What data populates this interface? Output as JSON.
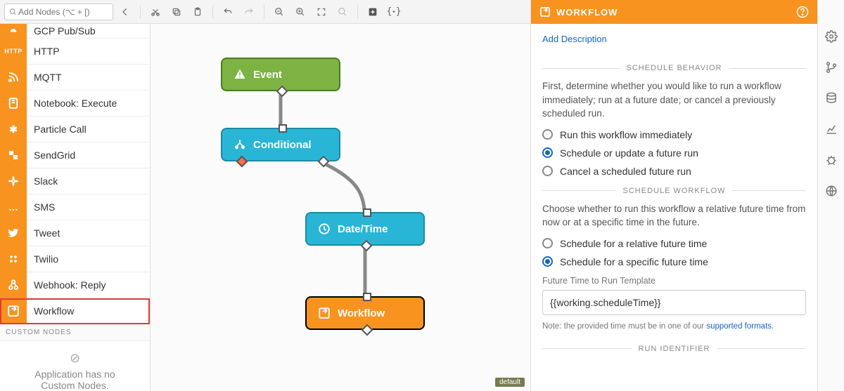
{
  "toolbar": {
    "search_placeholder": "Add Nodes (⌥ + [)"
  },
  "palette": {
    "items": [
      {
        "icon_text": "",
        "label": "GCP Pub/Sub",
        "icon_name": "gcp-icon"
      },
      {
        "icon_text": "HTTP",
        "label": "HTTP",
        "icon_name": "http-icon"
      },
      {
        "icon_text": "",
        "label": "MQTT",
        "icon_name": "wifi-icon"
      },
      {
        "icon_text": "",
        "label": "Notebook: Execute",
        "icon_name": "notebook-icon"
      },
      {
        "icon_text": "✱",
        "label": "Particle Call",
        "icon_name": "particle-icon"
      },
      {
        "icon_text": "",
        "label": "SendGrid",
        "icon_name": "sendgrid-icon"
      },
      {
        "icon_text": "",
        "label": "Slack",
        "icon_name": "slack-icon"
      },
      {
        "icon_text": "…",
        "label": "SMS",
        "icon_name": "sms-icon"
      },
      {
        "icon_text": "",
        "label": "Tweet",
        "icon_name": "twitter-icon"
      },
      {
        "icon_text": "",
        "label": "Twilio",
        "icon_name": "twilio-icon"
      },
      {
        "icon_text": "",
        "label": "Webhook: Reply",
        "icon_name": "webhook-icon"
      },
      {
        "icon_text": "",
        "label": "Workflow",
        "icon_name": "workflow-icon",
        "highlight": true
      }
    ],
    "custom_header": "CUSTOM NODES",
    "empty_line1": "Application has no",
    "empty_line2": "Custom Nodes."
  },
  "canvas": {
    "nodes": {
      "event": "Event",
      "conditional": "Conditional",
      "datetime": "Date/Time",
      "workflow": "Workflow"
    },
    "default_badge": "default"
  },
  "inspector": {
    "title": "WORKFLOW",
    "add_description": "Add Description",
    "sections": {
      "behavior": {
        "header": "SCHEDULE BEHAVIOR",
        "desc": "First, determine whether you would like to run a workflow immediately; run at a future date; or cancel a previously scheduled run.",
        "opt1": "Run this workflow immediately",
        "opt2": "Schedule or update a future run",
        "opt3": "Cancel a scheduled future run"
      },
      "schedule": {
        "header": "SCHEDULE WORKFLOW",
        "desc": "Choose whether to run this workflow a relative future time from now or at a specific time in the future.",
        "opt1": "Schedule for a relative future time",
        "opt2": "Schedule for a specific future time",
        "field_label": "Future Time to Run Template",
        "field_value": "{{working.scheduleTime}}",
        "note_prefix": "Note: the provided time must be in one of our ",
        "note_link": "supported formats",
        "note_suffix": "."
      },
      "run_id": {
        "header": "RUN IDENTIFIER"
      }
    }
  }
}
